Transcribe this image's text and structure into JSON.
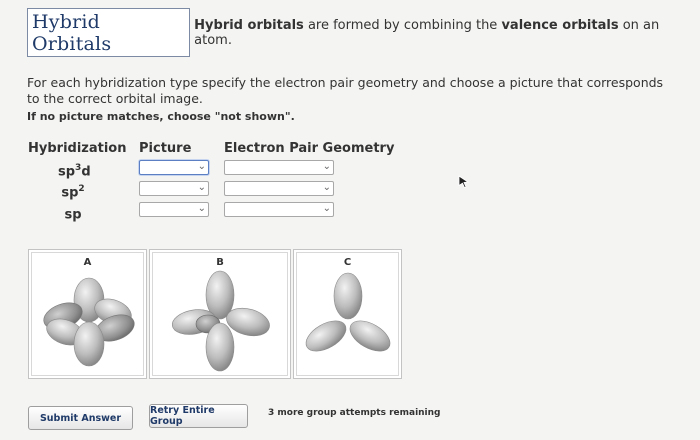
{
  "header": {
    "title": "Hybrid Orbitals",
    "desc_bold1": "Hybrid orbitals",
    "desc_mid": " are formed by combining the ",
    "desc_bold2": "valence orbitals",
    "desc_end": " on an atom."
  },
  "instructions": "For each hybridization type specify the electron pair geometry and choose a picture that corresponds to the correct orbital image.",
  "note": "If no picture matches, choose \"not shown\".",
  "table": {
    "headers": {
      "hybridization": "Hybridization",
      "picture": "Picture",
      "geometry": "Electron Pair Geometry"
    },
    "rows": [
      {
        "base": "sp",
        "sup": "3",
        "suffix": "d",
        "picture_value": "",
        "geometry_value": ""
      },
      {
        "base": "sp",
        "sup": "2",
        "suffix": "",
        "picture_value": "",
        "geometry_value": ""
      },
      {
        "base": "sp",
        "sup": "",
        "suffix": "",
        "picture_value": "",
        "geometry_value": ""
      }
    ]
  },
  "pictures": [
    {
      "label": "A",
      "icon": "orbital-octahedral-icon"
    },
    {
      "label": "B",
      "icon": "orbital-trigonal-bipyramidal-icon"
    },
    {
      "label": "C",
      "icon": "orbital-trigonal-planar-icon"
    }
  ],
  "buttons": {
    "submit": "Submit Answer",
    "retry": "Retry Entire Group"
  },
  "attempts": "3 more group attempts remaining",
  "colors": {
    "title_text": "#1f3a68",
    "lobe": "#b9b9b9",
    "focus_border": "#5b7fc2"
  }
}
